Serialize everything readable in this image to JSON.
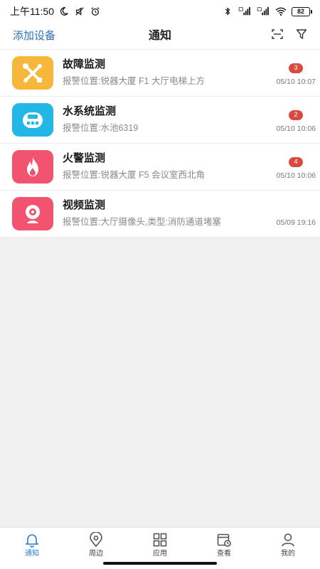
{
  "status_bar": {
    "time": "上午11:50",
    "battery": "82"
  },
  "nav": {
    "left_action": "添加设备",
    "title": "通知",
    "icons": [
      "scan-icon",
      "filter-icon"
    ]
  },
  "items": [
    {
      "title": "故障监测",
      "subtitle": "报警位置:锐器大厦 F1 大厅电梯上方",
      "badge": "3",
      "time": "05/10 10:07",
      "icon": "tools-icon",
      "color": "#f7b73a"
    },
    {
      "title": "水系统监测",
      "subtitle": "报警位置:水池6319",
      "badge": "2",
      "time": "05/10 10:06",
      "icon": "water-meter-icon",
      "color": "#23b7e8"
    },
    {
      "title": "火警监测",
      "subtitle": "报警位置:锐器大厦 F5 会议室西北角",
      "badge": "4",
      "time": "05/10 10:06",
      "icon": "flame-icon",
      "color": "#f25470"
    },
    {
      "title": "视频监测",
      "subtitle": "报警位置:大厅摄像头,类型:消防通道堵塞",
      "badge": "",
      "time": "05/09 19:16",
      "icon": "camera-icon",
      "color": "#f25470"
    }
  ],
  "tabs": [
    {
      "label": "通知",
      "icon": "bell-icon",
      "active": true
    },
    {
      "label": "周边",
      "icon": "location-icon",
      "active": false
    },
    {
      "label": "应用",
      "icon": "grid-icon",
      "active": false
    },
    {
      "label": "查看",
      "icon": "calendar-clock-icon",
      "active": false
    },
    {
      "label": "我的",
      "icon": "user-icon",
      "active": false
    }
  ],
  "colors": {
    "accent": "#2a7bd4",
    "link": "#2a6fb8",
    "badge": "#d84a3e"
  }
}
